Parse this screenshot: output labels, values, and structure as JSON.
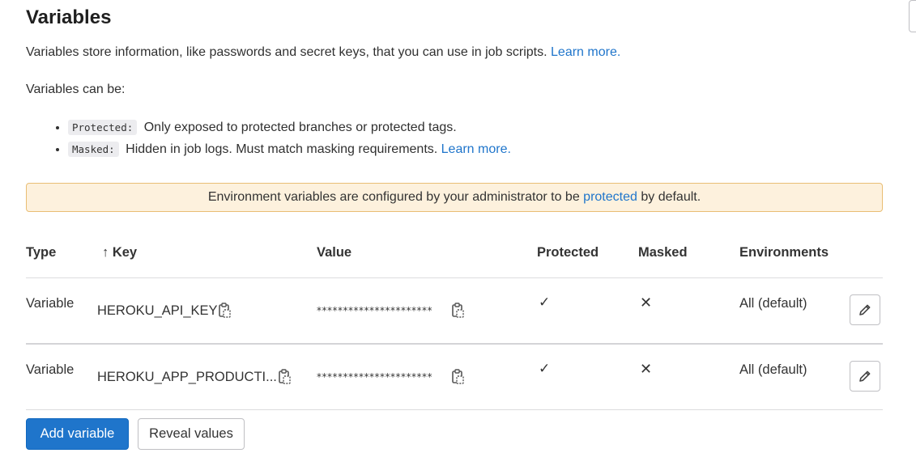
{
  "header": {
    "title": "Variables",
    "description": "Variables store information, like passwords and secret keys, that you can use in job scripts.",
    "learn_more": "Learn more.",
    "can_be": "Variables can be:"
  },
  "bullets": [
    {
      "tag": "Protected:",
      "text": "Only exposed to protected branches or protected tags.",
      "link": ""
    },
    {
      "tag": "Masked:",
      "text": "Hidden in job logs. Must match masking requirements.",
      "link": "Learn more."
    }
  ],
  "alert": {
    "before": "Environment variables are configured by your administrator to be",
    "link": "protected",
    "after": "by default."
  },
  "table": {
    "headers": {
      "type": "Type",
      "key_arrow": "↑",
      "key": "Key",
      "value": "Value",
      "protected": "Protected",
      "masked": "Masked",
      "environments": "Environments"
    },
    "rows": [
      {
        "type": "Variable",
        "key": "HEROKU_API_KEY",
        "value": "**********************",
        "protected": "✓",
        "masked": "✕",
        "environments": "All (default)"
      },
      {
        "type": "Variable",
        "key": "HEROKU_APP_PRODUCTI...",
        "value": "**********************",
        "protected": "✓",
        "masked": "✕",
        "environments": "All (default)"
      }
    ]
  },
  "actions": {
    "add_variable": "Add variable",
    "reveal_values": "Reveal values"
  },
  "colors": {
    "accent": "#1f75cb",
    "alert_bg": "#fdf1dd",
    "alert_border": "#e9be74"
  }
}
